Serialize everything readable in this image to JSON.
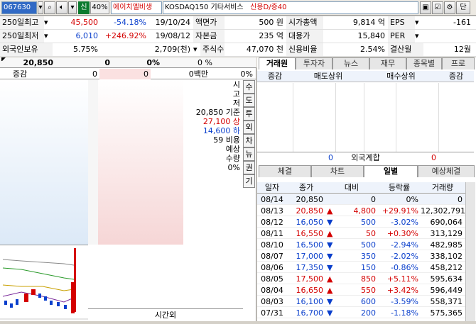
{
  "toolbar": {
    "code": "067630",
    "credit_badge": "신",
    "margin_pct": "40%",
    "stock_name": "에이치엘비생",
    "market": "KOSDAQ150 기타서비스",
    "credit_info": "신용D/증40",
    "right_btn": "단"
  },
  "info": {
    "high250_label": "250일최고",
    "high250_price": "45,500",
    "high250_pct": "-54.18%",
    "high250_date": "19/10/24",
    "par_label": "액면가",
    "par_value": "500 원",
    "mktcap_label": "시가총액",
    "mktcap_value": "9,814 억",
    "eps_label": "EPS",
    "eps_value": "-161",
    "low250_label": "250일최저",
    "low250_price": "6,010",
    "low250_pct": "+246.92%",
    "low250_date": "19/08/12",
    "capital_label": "자본금",
    "capital_value": "235 억",
    "substitute_label": "대용가",
    "substitute_value": "15,840",
    "per_label": "PER",
    "per_value": "",
    "foreign_label": "외국인보유",
    "foreign_pct": "5.75%",
    "foreign_qty": "2,709(천)",
    "shares_label": "주식수",
    "shares_value": "47,070 천",
    "credit_ratio_label": "신용비율",
    "credit_ratio_value": "2.54%",
    "fiscal_label": "결산월",
    "fiscal_value": "12월"
  },
  "left": {
    "sum_price": "20,850",
    "sum_a": "0",
    "sum_b": "0%",
    "sum_c": "0 %",
    "diff_label": "증감",
    "diff_a": "0",
    "diff_b": "0",
    "diff_c": "0백만",
    "diff_d": "0%",
    "si": "시",
    "go": "고",
    "jeo": "저",
    "base_price": "20,850",
    "base_label": "기준",
    "upper_price": "27,100",
    "upper_label": "상",
    "lower_price": "14,600",
    "lower_label": "하",
    "ratio_value": "59",
    "ratio_label": "비용",
    "expect_label1": "예상",
    "expect_label2": "수량",
    "expect_pct": "0%",
    "side_buttons": [
      "수",
      "도",
      "투",
      "외",
      "차",
      "뉴",
      "권",
      "기"
    ],
    "after_hours": "시간외"
  },
  "right": {
    "tabs_top": [
      "거래원",
      "투자자",
      "뉴스",
      "재무",
      "종목별",
      "프로"
    ],
    "broker_headers": [
      "증감",
      "매도상위",
      "매수상위",
      "증감"
    ],
    "foreign_sell": "0",
    "foreign_label": "외국계합",
    "foreign_buy": "0",
    "tabs_bottom": [
      "체결",
      "차트",
      "일별",
      "예상체결"
    ],
    "daily_headers": [
      "일자",
      "종가",
      "대비",
      "등락률",
      "거래량"
    ],
    "daily_rows": [
      {
        "date": "08/14",
        "close": "20,850",
        "change": "0",
        "rate": "0%",
        "volume": "0",
        "dir": "flat"
      },
      {
        "date": "08/13",
        "close": "20,850",
        "change": "4,800",
        "rate": "+29.91%",
        "volume": "12,302,791",
        "dir": "up"
      },
      {
        "date": "08/12",
        "close": "16,050",
        "change": "500",
        "rate": "-3.02%",
        "volume": "690,064",
        "dir": "down"
      },
      {
        "date": "08/11",
        "close": "16,550",
        "change": "50",
        "rate": "+0.30%",
        "volume": "313,129",
        "dir": "up"
      },
      {
        "date": "08/10",
        "close": "16,500",
        "change": "500",
        "rate": "-2.94%",
        "volume": "482,985",
        "dir": "down"
      },
      {
        "date": "08/07",
        "close": "17,000",
        "change": "350",
        "rate": "-2.02%",
        "volume": "338,102",
        "dir": "down"
      },
      {
        "date": "08/06",
        "close": "17,350",
        "change": "150",
        "rate": "-0.86%",
        "volume": "458,212",
        "dir": "down"
      },
      {
        "date": "08/05",
        "close": "17,500",
        "change": "850",
        "rate": "+5.11%",
        "volume": "595,634",
        "dir": "up"
      },
      {
        "date": "08/04",
        "close": "16,650",
        "change": "550",
        "rate": "+3.42%",
        "volume": "596,449",
        "dir": "up"
      },
      {
        "date": "08/03",
        "close": "16,100",
        "change": "600",
        "rate": "-3.59%",
        "volume": "558,371",
        "dir": "down"
      },
      {
        "date": "07/31",
        "close": "16,700",
        "change": "200",
        "rate": "-1.18%",
        "volume": "575,365",
        "dir": "down"
      }
    ]
  },
  "colors": {
    "up": "#d40000",
    "down": "#0a3fcc",
    "accent": "#316ac5"
  }
}
